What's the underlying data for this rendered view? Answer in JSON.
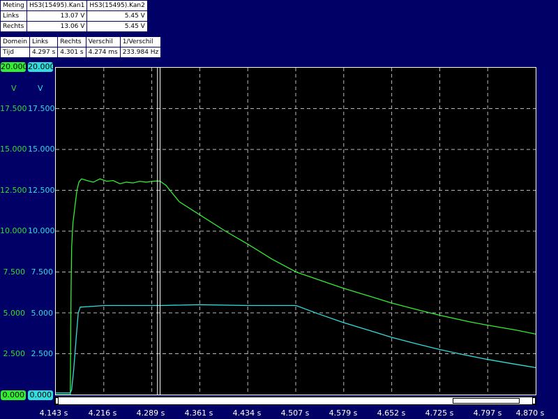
{
  "measurement": {
    "headers": [
      "Meting",
      "HS3(15495).Kan1",
      "HS3(15495).Kan2"
    ],
    "rows": [
      [
        "Links",
        "13.07 V",
        "5.45 V"
      ],
      [
        "Rechts",
        "13.06 V",
        "5.45 V"
      ]
    ]
  },
  "cursors": {
    "headers": [
      "Domein",
      "Links",
      "Rechts",
      "Verschil",
      "1/Verschil"
    ],
    "row": [
      "Tijd",
      "4.297 s",
      "4.301 s",
      "4.274 ms",
      "233.984 Hz"
    ]
  },
  "channels": {
    "ch1": {
      "top": "20.000",
      "bottom": "0.000",
      "unit": "V",
      "color": "#33ee33"
    },
    "ch2": {
      "top": "20.000",
      "bottom": "0.000",
      "unit": "V",
      "color": "#33dddd"
    }
  },
  "chart_data": {
    "type": "line",
    "xlabel": "",
    "ylabel": "",
    "xlim": [
      4.143,
      4.87
    ],
    "ylim": [
      0,
      20
    ],
    "x_ticks": [
      "4.143 s",
      "4.216 s",
      "4.289 s",
      "4.361 s",
      "4.434 s",
      "4.507 s",
      "4.579 s",
      "4.652 s",
      "4.725 s",
      "4.797 s",
      "4.870 s"
    ],
    "y_ticks": [
      "17.500",
      "15.000",
      "12.500",
      "10.000",
      "7.500",
      "5.000",
      "2.500"
    ],
    "grid": true,
    "cursors_x": [
      4.297,
      4.301
    ],
    "series": [
      {
        "color": "#33ee33",
        "points": [
          [
            4.143,
            0.0
          ],
          [
            4.165,
            0.0
          ],
          [
            4.166,
            6.0
          ],
          [
            4.167,
            9.0
          ],
          [
            4.169,
            10.5
          ],
          [
            4.172,
            11.5
          ],
          [
            4.175,
            12.5
          ],
          [
            4.178,
            13.0
          ],
          [
            4.182,
            13.2
          ],
          [
            4.19,
            13.1
          ],
          [
            4.2,
            13.0
          ],
          [
            4.21,
            13.2
          ],
          [
            4.22,
            13.05
          ],
          [
            4.23,
            13.1
          ],
          [
            4.24,
            12.9
          ],
          [
            4.25,
            13.0
          ],
          [
            4.26,
            12.95
          ],
          [
            4.27,
            13.05
          ],
          [
            4.28,
            13.0
          ],
          [
            4.29,
            13.05
          ],
          [
            4.297,
            13.07
          ],
          [
            4.301,
            13.06
          ],
          [
            4.31,
            12.8
          ],
          [
            4.33,
            11.8
          ],
          [
            4.361,
            11.0
          ],
          [
            4.4,
            10.0
          ],
          [
            4.434,
            9.2
          ],
          [
            4.47,
            8.3
          ],
          [
            4.507,
            7.5
          ],
          [
            4.55,
            6.9
          ],
          [
            4.579,
            6.5
          ],
          [
            4.62,
            6.0
          ],
          [
            4.652,
            5.6
          ],
          [
            4.7,
            5.1
          ],
          [
            4.725,
            4.85
          ],
          [
            4.77,
            4.45
          ],
          [
            4.797,
            4.25
          ],
          [
            4.84,
            3.95
          ],
          [
            4.87,
            3.7
          ]
        ]
      },
      {
        "color": "#33dddd",
        "points": [
          [
            4.143,
            0.1
          ],
          [
            4.165,
            0.1
          ],
          [
            4.167,
            0.3
          ],
          [
            4.17,
            1.5
          ],
          [
            4.174,
            3.5
          ],
          [
            4.177,
            5.0
          ],
          [
            4.18,
            5.35
          ],
          [
            4.2,
            5.4
          ],
          [
            4.216,
            5.45
          ],
          [
            4.25,
            5.45
          ],
          [
            4.289,
            5.45
          ],
          [
            4.297,
            5.45
          ],
          [
            4.301,
            5.45
          ],
          [
            4.361,
            5.5
          ],
          [
            4.434,
            5.45
          ],
          [
            4.48,
            5.45
          ],
          [
            4.507,
            5.45
          ],
          [
            4.54,
            4.95
          ],
          [
            4.579,
            4.4
          ],
          [
            4.62,
            3.9
          ],
          [
            4.652,
            3.5
          ],
          [
            4.69,
            3.1
          ],
          [
            4.725,
            2.75
          ],
          [
            4.76,
            2.45
          ],
          [
            4.797,
            2.15
          ],
          [
            4.84,
            1.85
          ],
          [
            4.87,
            1.65
          ]
        ]
      }
    ]
  }
}
